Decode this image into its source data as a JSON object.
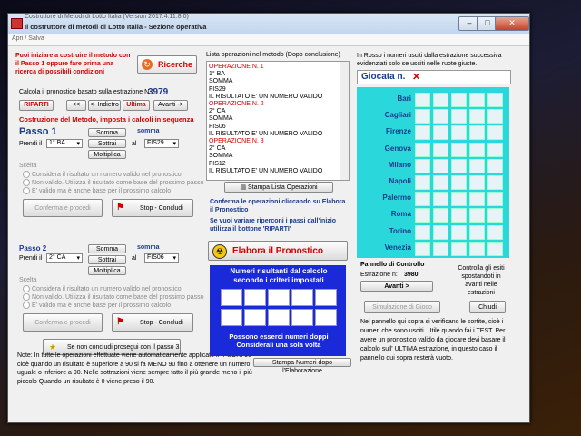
{
  "window": {
    "title": "Costruttore di Metodi di Lotto Italia (Version 2017.4.11.8.0)",
    "subtitle": "Il costruttore di metodi di Lotto Italia - Sezione operativa"
  },
  "menu": {
    "item": "Apri / Salva"
  },
  "left": {
    "intro_text": "Puoi iniziare a costruire il metodo con il Passo 1 oppure fare prima una ricerca di possibili condizioni",
    "ricerche_label": "Ricerche",
    "calc_label": "Calcola il pronostico basato sulla estrazione N.",
    "estrazione": "3979",
    "ripartire_label": "RIPARTI",
    "back_label": "<<",
    "indietro_label": "<- Indietro",
    "ultima_label": "Ultima",
    "avanti_label": "Avanti ->",
    "section_title": "Costruzione del Metodo, imposta i calcoli in sequenza",
    "passo1": {
      "title": "Passo 1",
      "prendi": "Prendi il",
      "sel1": "1° BA",
      "somma": "Somma",
      "sottrai": "Sottrai",
      "moltiplica": "Moltiplica",
      "op_label": "somma",
      "al": "al",
      "sel2": "FIS29",
      "scelta": "Scelta",
      "opt1": "Considera il risultato un numero valido nel pronostico",
      "opt2": "Non valido. Utilizza il risultato come base del prossimo passo",
      "opt3": "E' valido ma è anche base per il prossimo calcolo",
      "conferma": "Conferma e procedi",
      "stop": "Stop - Concludi"
    },
    "passo2": {
      "title": "Passo 2",
      "prendi": "Prendi il",
      "sel1": "2° CA",
      "somma": "Somma",
      "sottrai": "Sottrai",
      "moltiplica": "Moltiplica",
      "op_label": "somma",
      "al": "al",
      "sel2": "FIS06",
      "scelta": "Scelta",
      "opt1": "Considera il risultato un numero valido nel pronostico",
      "opt2": "Non valido. Utilizza il risultato come base del prossimo passo",
      "opt3": "E' valido ma è anche base per il prossimo calcolo",
      "conferma": "Conferma e procedi",
      "stop": "Stop - Concludi"
    },
    "prosegui_label": "Se non concludi prosegui con il passo 3",
    "note": "Note: In tutte le operazioni effettuate viene automaticamente applicato il \"FUORI 90\" cioè quando un risultato è superiore a 90 si fa MENO 90 fino a ottenere un numero uguale o inferiore a 90. Nelle sottrazioni viene sempre fatto il più grande meno il più piccolo Quando un risultato è 0 viene preso il 90."
  },
  "middle": {
    "list_title": "Lista operazioni nel metodo (Dopo conclusione)",
    "ops": [
      {
        "t": "OPERAZIONE N. 1",
        "red": true
      },
      {
        "t": "1° BA",
        "red": false
      },
      {
        "t": "SOMMA",
        "red": false
      },
      {
        "t": "FIS29",
        "red": false
      },
      {
        "t": "IL RISULTATO E' UN NUMERO VALIDO",
        "red": false
      },
      {
        "t": "OPERAZIONE N. 2",
        "red": true
      },
      {
        "t": "2° CA",
        "red": false
      },
      {
        "t": "SOMMA",
        "red": false
      },
      {
        "t": "FIS06",
        "red": false
      },
      {
        "t": "IL RISULTATO E' UN NUMERO VALIDO",
        "red": false
      },
      {
        "t": "OPERAZIONE N. 3",
        "red": true
      },
      {
        "t": "2° CA",
        "red": false
      },
      {
        "t": "SOMMA",
        "red": false
      },
      {
        "t": "FIS12",
        "red": false
      },
      {
        "t": "IL RISULTATO E' UN NUMERO VALIDO",
        "red": false
      }
    ],
    "stampa_lista": "Stampa Lista Operazioni",
    "conferma_text": "Conferma le operazioni cliccando su Elabora il Pronostico",
    "riparti_text": "Se vuoi variare riperconi i passi dall'inizio utilizza il bottone 'RIPARTI'",
    "elabora_label": "Elabora il Pronostico",
    "numeri_title": "Numeri risultanti dal calcolo secondo i criteri impostati",
    "numeri_foot": "Possono esserci numeri doppi Considerali una sola volta",
    "stampa_numeri": "Stampa Numeri dopo l'Elaborazione"
  },
  "right": {
    "info": "In Rosso i numeri usciti dalla estrazione successiva evidenziati solo se usciti nelle ruote giuste.",
    "giocata_label": "Giocata n.",
    "ruote": [
      "Bari",
      "Cagliari",
      "Firenze",
      "Genova",
      "Milano",
      "Napoli",
      "Palermo",
      "Roma",
      "Torino",
      "Venezia"
    ],
    "pannello_title": "Pannello di Controllo",
    "estr_label": "Estrazione n:",
    "estr_value": "3980",
    "avanti_label": "Avanti >",
    "controlla_text": "Controlla gli esiti spostandoti in avanti nelle estrazioni",
    "simulazione_label": "Simulazione di Gioco",
    "chiudi_label": "Chiudi",
    "bottom_text": "Nel pannello qui sopra si verificano le sortite, cioè i numeri che sono usciti. Utile quando fai i TEST. Per avere un pronostico valido da giocare devi basare il calcolo sull' ULTIMA estrazione, in questo caso il pannello qui sopra resterà vuoto."
  }
}
